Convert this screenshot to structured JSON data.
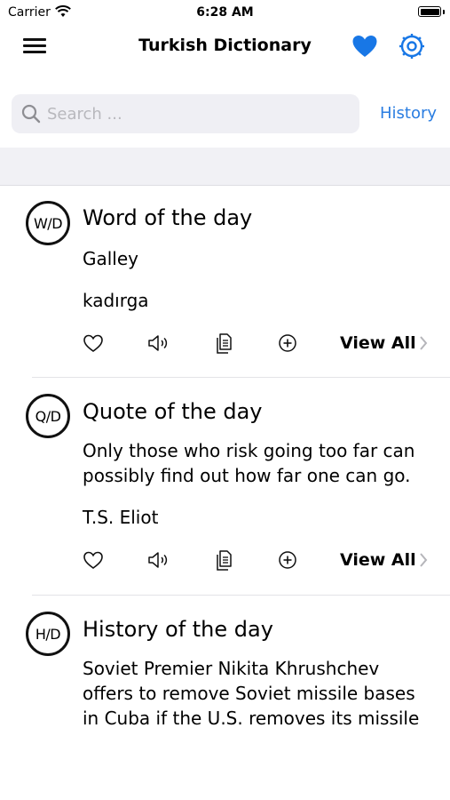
{
  "status_bar": {
    "carrier": "Carrier",
    "time": "6:28 AM"
  },
  "nav": {
    "title": "Turkish Dictionary"
  },
  "search": {
    "placeholder": "Search ...",
    "history_label": "History"
  },
  "colors": {
    "accent": "#2a7de1",
    "band": "#f1f1f5"
  },
  "cards": [
    {
      "badge": "W/D",
      "title": "Word of the day",
      "lines": [
        "Galley",
        "kadırga"
      ],
      "view_all": "View All"
    },
    {
      "badge": "Q/D",
      "title": "Quote of the day",
      "lines": [
        "Only those who risk going too far can",
        "possibly find out how far one can go.",
        "T.S. Eliot"
      ],
      "view_all": "View All"
    },
    {
      "badge": "H/D",
      "title": "History of the day",
      "lines": [
        "Soviet Premier Nikita Khrushchev",
        "offers to remove Soviet missile bases",
        "in Cuba if the U.S. removes its missile"
      ]
    }
  ],
  "icons": [
    "wifi-icon",
    "menu-icon",
    "heart-icon",
    "gear-icon",
    "search-icon",
    "heart-outline-icon",
    "speaker-icon",
    "copy-icon",
    "add-icon",
    "chevron-right-icon"
  ]
}
